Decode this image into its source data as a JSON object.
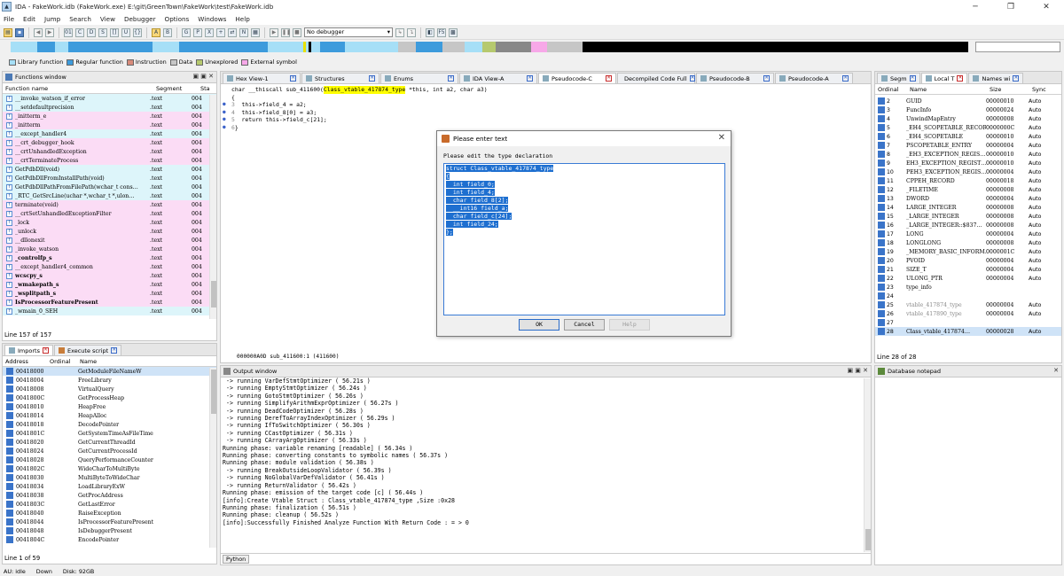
{
  "window": {
    "title": "IDA - FakeWork.idb (FakeWork.exe) E:\\git\\GreenTown\\FakeWork\\test\\FakeWork.idb",
    "icon": "ida-icon"
  },
  "menu": [
    "File",
    "Edit",
    "Jump",
    "Search",
    "View",
    "Debugger",
    "Options",
    "Windows",
    "Help"
  ],
  "toolbar": {
    "debugger": "No debugger"
  },
  "legend": [
    {
      "label": "Library function",
      "color": "#a6dff7"
    },
    {
      "label": "Regular function",
      "color": "#3d9bdc"
    },
    {
      "label": "Instruction",
      "color": "#d88b7a"
    },
    {
      "label": "Data",
      "color": "#c6c6c6"
    },
    {
      "label": "Unexplored",
      "color": "#b6c96e"
    },
    {
      "label": "External symbol",
      "color": "#f7a8e8"
    }
  ],
  "functions": {
    "title": "Functions window",
    "columns": [
      "Function name",
      "Segment",
      "Sta"
    ],
    "rows": [
      {
        "name": "__invoke_watson_if_error",
        "seg": ".text",
        "sta": "004",
        "bg": "#ddf5fa"
      },
      {
        "name": "__setdefaultprecision",
        "seg": ".text",
        "sta": "004",
        "bg": "#ddf5fa"
      },
      {
        "name": "_initterm_e",
        "seg": ".text",
        "sta": "004",
        "bg": "#fbdcf5"
      },
      {
        "name": "_initterm",
        "seg": ".text",
        "sta": "004",
        "bg": "#fbdcf5"
      },
      {
        "name": "__except_handler4",
        "seg": ".text",
        "sta": "004",
        "bg": "#ddf5fa"
      },
      {
        "name": "__crt_debugger_hook",
        "seg": ".text",
        "sta": "004",
        "bg": "#fbdcf5"
      },
      {
        "name": "__crtUnhandledException",
        "seg": ".text",
        "sta": "004",
        "bg": "#fbdcf5"
      },
      {
        "name": "__crtTerminateProcess",
        "seg": ".text",
        "sta": "004",
        "bg": "#fbdcf5"
      },
      {
        "name": "GetPdbDll(void)",
        "seg": ".text",
        "sta": "004",
        "bg": "#ddf5fa"
      },
      {
        "name": "GetPdbDllFromInstallPath(void)",
        "seg": ".text",
        "sta": "004",
        "bg": "#ddf5fa"
      },
      {
        "name": "GetPdbDllPathFromFilePath(wchar_t cons…",
        "seg": ".text",
        "sta": "004",
        "bg": "#ddf5fa"
      },
      {
        "name": "_RTC_GetSrcLine(uchar *,wchar_t *,ulon…",
        "seg": ".text",
        "sta": "004",
        "bg": "#ddf5fa"
      },
      {
        "name": "terminate(void)",
        "seg": ".text",
        "sta": "004",
        "bg": "#fbdcf5"
      },
      {
        "name": "__crtSetUnhandledExceptionFilter",
        "seg": ".text",
        "sta": "004",
        "bg": "#fbdcf5"
      },
      {
        "name": "_lock",
        "seg": ".text",
        "sta": "004",
        "bg": "#fbdcf5"
      },
      {
        "name": "_unlock",
        "seg": ".text",
        "sta": "004",
        "bg": "#fbdcf5"
      },
      {
        "name": "__dllonexit",
        "seg": ".text",
        "sta": "004",
        "bg": "#fbdcf5"
      },
      {
        "name": "_invoke_watson",
        "seg": ".text",
        "sta": "004",
        "bg": "#fbdcf5"
      },
      {
        "name": "_controlfp_s",
        "seg": ".text",
        "sta": "004",
        "bg": "#fbdcf5",
        "bold": true
      },
      {
        "name": "__except_handler4_common",
        "seg": ".text",
        "sta": "004",
        "bg": "#fbdcf5"
      },
      {
        "name": "wcscpy_s",
        "seg": ".text",
        "sta": "004",
        "bg": "#fbdcf5",
        "bold": true
      },
      {
        "name": "_wmakepath_s",
        "seg": ".text",
        "sta": "004",
        "bg": "#fbdcf5",
        "bold": true
      },
      {
        "name": "_wsplitpath_s",
        "seg": ".text",
        "sta": "004",
        "bg": "#fbdcf5",
        "bold": true
      },
      {
        "name": "IsProcessorFeaturePresent",
        "seg": ".text",
        "sta": "004",
        "bg": "#fbdcf5",
        "bold": true
      },
      {
        "name": "_wmain_0_SEH",
        "seg": ".text",
        "sta": "004",
        "bg": "#ddf5fa"
      }
    ],
    "status": "Line 157 of 157"
  },
  "imports_tabs": [
    {
      "label": "Imports",
      "active": true
    },
    {
      "label": "Execute script",
      "active": false
    }
  ],
  "imports": {
    "columns": [
      "Address",
      "Ordinal",
      "Name"
    ],
    "rows": [
      {
        "addr": "00418000",
        "name": "GetModuleFileNameW"
      },
      {
        "addr": "00418004",
        "name": "FreeLibrary"
      },
      {
        "addr": "00418008",
        "name": "VirtualQuery"
      },
      {
        "addr": "0041800C",
        "name": "GetProcessHeap"
      },
      {
        "addr": "00418010",
        "name": "HeapFree"
      },
      {
        "addr": "00418014",
        "name": "HeapAlloc"
      },
      {
        "addr": "00418018",
        "name": "DecodePointer"
      },
      {
        "addr": "0041801C",
        "name": "GetSystemTimeAsFileTime"
      },
      {
        "addr": "00418020",
        "name": "GetCurrentThreadId"
      },
      {
        "addr": "00418024",
        "name": "GetCurrentProcessId"
      },
      {
        "addr": "00418028",
        "name": "QueryPerformanceCounter"
      },
      {
        "addr": "0041802C",
        "name": "WideCharToMultiByte"
      },
      {
        "addr": "00418030",
        "name": "MultiByteToWideChar"
      },
      {
        "addr": "00418034",
        "name": "LoadLibraryExW"
      },
      {
        "addr": "00418038",
        "name": "GetProcAddress"
      },
      {
        "addr": "0041803C",
        "name": "GetLastError"
      },
      {
        "addr": "00418040",
        "name": "RaiseException"
      },
      {
        "addr": "00418044",
        "name": "IsProcessorFeaturePresent"
      },
      {
        "addr": "00418048",
        "name": "IsDebuggerPresent"
      },
      {
        "addr": "0041804C",
        "name": "EncodePointer"
      }
    ],
    "status": "Line 1 of 59"
  },
  "center_tabs": [
    {
      "label": "Hex View-1",
      "xc": "blue",
      "active": false
    },
    {
      "label": "Structures",
      "xc": "blue",
      "active": false
    },
    {
      "label": "Enums",
      "xc": "blue",
      "active": false
    },
    {
      "label": "IDA View-A",
      "xc": "blue",
      "active": false
    },
    {
      "label": "Pseudocode-C",
      "xc": "red",
      "active": true
    },
    {
      "label": "Decompiled Code Full",
      "xc": "blue",
      "active": false
    },
    {
      "label": "Pseudocode-B",
      "xc": "blue",
      "active": false
    },
    {
      "label": "Pseudocode-A",
      "xc": "blue",
      "active": false
    }
  ],
  "pseudocode": {
    "sig_pre": "char __thiscall sub_411600(",
    "sig_hl": "Class_vtable_417874_type",
    "sig_post": " *this, int a2, char a3)",
    "lines": [
      {
        "no": "",
        "text": "{"
      },
      {
        "no": "3",
        "text": "  this->field_4 = a2;"
      },
      {
        "no": "4",
        "text": "  this->field_8[0] = a3;"
      },
      {
        "no": "5",
        "text": "  return this->field_c[21];"
      },
      {
        "no": "6",
        "text": "}"
      }
    ],
    "status": "000000A0D sub_411600:1 (411600)"
  },
  "dialog": {
    "title": "Please enter text",
    "label": "Please edit the type declaration",
    "text": [
      "struct Class_vtable_417874_type",
      "{",
      "  int field_0;",
      "  int field_4;",
      "  char field_8[2];",
      "  __int16 field_a;",
      "  char field_c[24];",
      "  int field_24;",
      "};"
    ],
    "ok": "OK",
    "cancel": "Cancel",
    "help": "Help"
  },
  "output": {
    "title": "Output window",
    "lines": [
      " -> running VarDefStmtOptimizer ( 56.21s )",
      " -> running EmptyStmtOptimizer ( 56.24s )",
      " -> running GotoStmtOptimizer ( 56.26s )",
      " -> running SimplifyArithmExprOptimizer ( 56.27s )",
      " -> running DeadCodeOptimizer ( 56.28s )",
      " -> running DerefToArrayIndexOptimizer ( 56.29s )",
      " -> running IfToSwitchOptimizer ( 56.30s )",
      " -> running CCastOptimizer ( 56.31s )",
      " -> running CArrayArgOptimizer ( 56.33s )",
      "Running phase: variable renaming [readable] ( 56.34s )",
      "Running phase: converting constants to symbolic names ( 56.37s )",
      "Running phase: module validation ( 56.38s )",
      " -> running BreakOutsideLoopValidator ( 56.39s )",
      " -> running NoGlobalVarDefValidator ( 56.41s )",
      " -> running ReturnValidator ( 56.42s )",
      "Running phase: emission of the target code [c] ( 56.44s )",
      "[info]:Create Vtable Struct : Class_vtable_417874_type ,Size :0x28",
      "Running phase: finalization ( 56.51s )",
      "Running phase: cleanup ( 56.52s )",
      "[info]:Successfully Finished Analyze Function With Return Code : = > 0"
    ],
    "tab": "Python"
  },
  "right_tabs": [
    {
      "label": "Segm",
      "active": false
    },
    {
      "label": "Local T",
      "active": true
    },
    {
      "label": "Names wi",
      "active": false
    }
  ],
  "local_types": {
    "columns": [
      "Ordinal",
      "Name",
      "Size",
      "Sync"
    ],
    "rows": [
      {
        "ord": "2",
        "name": "GUID",
        "size": "00000010",
        "sync": "Auto"
      },
      {
        "ord": "3",
        "name": "FuncInfo",
        "size": "00000024",
        "sync": "Auto"
      },
      {
        "ord": "4",
        "name": "UnwindMapEntry",
        "size": "00000008",
        "sync": "Auto"
      },
      {
        "ord": "5",
        "name": "_EH4_SCOPETABLE_RECORD",
        "size": "0000000C",
        "sync": "Auto"
      },
      {
        "ord": "6",
        "name": "_EH4_SCOPETABLE",
        "size": "00000010",
        "sync": "Auto"
      },
      {
        "ord": "7",
        "name": "PSCOPETABLE_ENTRY",
        "size": "00000004",
        "sync": "Auto"
      },
      {
        "ord": "8",
        "name": "_EH3_EXCEPTION_REGIS…",
        "size": "00000010",
        "sync": "Auto"
      },
      {
        "ord": "9",
        "name": "EH3_EXCEPTION_REGIST…",
        "size": "00000010",
        "sync": "Auto"
      },
      {
        "ord": "10",
        "name": "PEH3_EXCEPTION_REGIS…",
        "size": "00000004",
        "sync": "Auto"
      },
      {
        "ord": "11",
        "name": "CPPEH_RECORD",
        "size": "00000018",
        "sync": "Auto"
      },
      {
        "ord": "12",
        "name": "_FILETIME",
        "size": "00000008",
        "sync": "Auto"
      },
      {
        "ord": "13",
        "name": "DWORD",
        "size": "00000004",
        "sync": "Auto"
      },
      {
        "ord": "14",
        "name": "LARGE_INTEGER",
        "size": "00000008",
        "sync": "Auto"
      },
      {
        "ord": "15",
        "name": "_LARGE_INTEGER",
        "size": "00000008",
        "sync": "Auto"
      },
      {
        "ord": "16",
        "name": "_LARGE_INTEGER::$837…",
        "size": "00000008",
        "sync": "Auto"
      },
      {
        "ord": "17",
        "name": "LONG",
        "size": "00000004",
        "sync": "Auto"
      },
      {
        "ord": "18",
        "name": "LONGLONG",
        "size": "00000008",
        "sync": "Auto"
      },
      {
        "ord": "19",
        "name": "_MEMORY_BASIC_INFORM…",
        "size": "0000001C",
        "sync": "Auto"
      },
      {
        "ord": "20",
        "name": "PVOID",
        "size": "00000004",
        "sync": "Auto"
      },
      {
        "ord": "21",
        "name": "SIZE_T",
        "size": "00000004",
        "sync": "Auto"
      },
      {
        "ord": "22",
        "name": "ULONG_PTR",
        "size": "00000004",
        "sync": "Auto"
      },
      {
        "ord": "23",
        "name": "type_info",
        "size": "",
        "sync": ""
      },
      {
        "ord": "24",
        "name": "",
        "size": "",
        "sync": ""
      },
      {
        "ord": "25",
        "name": "vtable_417874_type",
        "size": "00000004",
        "sync": "Auto"
      },
      {
        "ord": "26",
        "name": "vtable_417890_type",
        "size": "00000004",
        "sync": "Auto"
      },
      {
        "ord": "27",
        "name": "",
        "size": "",
        "sync": ""
      },
      {
        "ord": "28",
        "name": "Class_vtable_417874…",
        "size": "00000028",
        "sync": "Auto"
      }
    ],
    "status": "Line 28 of 28"
  },
  "notepad": {
    "title": "Database notepad"
  },
  "statusbar": {
    "au": "AU:",
    "state": "idle",
    "dir": "Down",
    "disk": "Disk: 92GB"
  }
}
